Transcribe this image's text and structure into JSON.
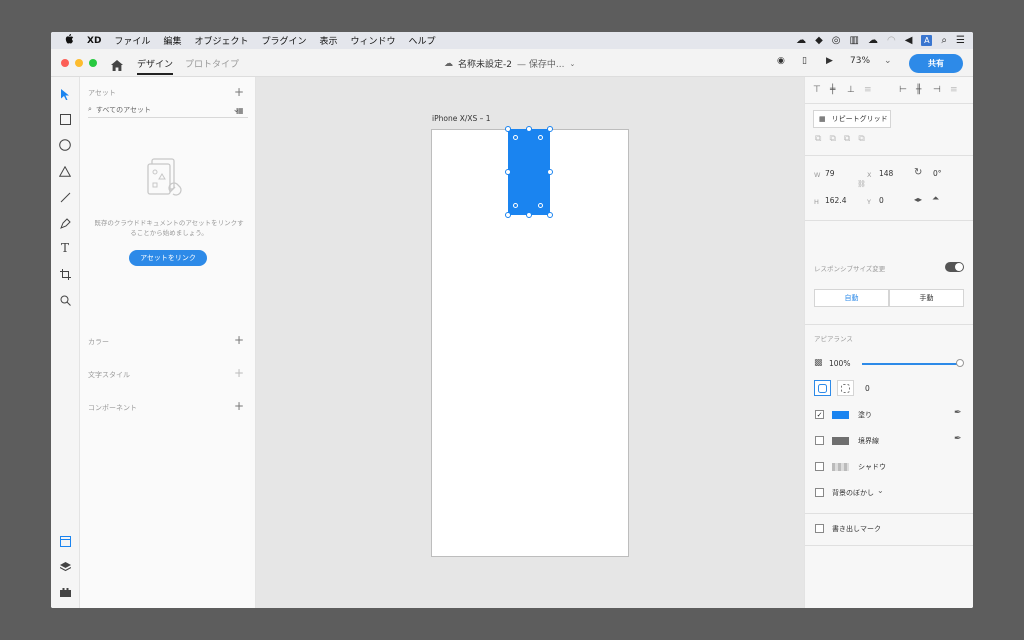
{
  "menubar": {
    "apple": "",
    "app": "XD",
    "items": [
      "ファイル",
      "編集",
      "オブジェクト",
      "プラグイン",
      "表示",
      "ウィンドウ",
      "ヘルプ"
    ],
    "status_a": "A"
  },
  "titlebar": {
    "tab_design": "デザイン",
    "tab_prototype": "プロトタイプ",
    "doc_title": "名称未設定-2",
    "doc_status": "— 保存中...",
    "zoom": "73%",
    "share": "共有"
  },
  "assets": {
    "title": "アセット",
    "search_placeholder": "すべてのアセット",
    "empty_text": "既存のクラウドドキュメントのアセットをリンクすることから始めましょう。",
    "link_button": "アセットをリンク",
    "sections": [
      "カラー",
      "文字スタイル",
      "コンポーネント"
    ]
  },
  "canvas": {
    "artboard_label": "iPhone X/XS – 1"
  },
  "props": {
    "repeat_grid": "リピートグリッド",
    "w_label": "W",
    "w": "79",
    "x_label": "X",
    "x": "148",
    "rotation": "0°",
    "h_label": "H",
    "h": "162.4",
    "y_label": "Y",
    "y": "0",
    "responsive_label": "レスポンシブサイズ変更",
    "auto": "自動",
    "manual": "手動",
    "appearance": "アピアランス",
    "opacity": "100%",
    "opacity_value": 1.0,
    "radius": "0",
    "fill": "塗り",
    "fill_color": "#1a84f0",
    "border": "境界線",
    "border_color": "#6f6f6f",
    "shadow": "シャドウ",
    "bg_blur": "背景のぼかし",
    "export_mark": "書き出しマーク"
  }
}
